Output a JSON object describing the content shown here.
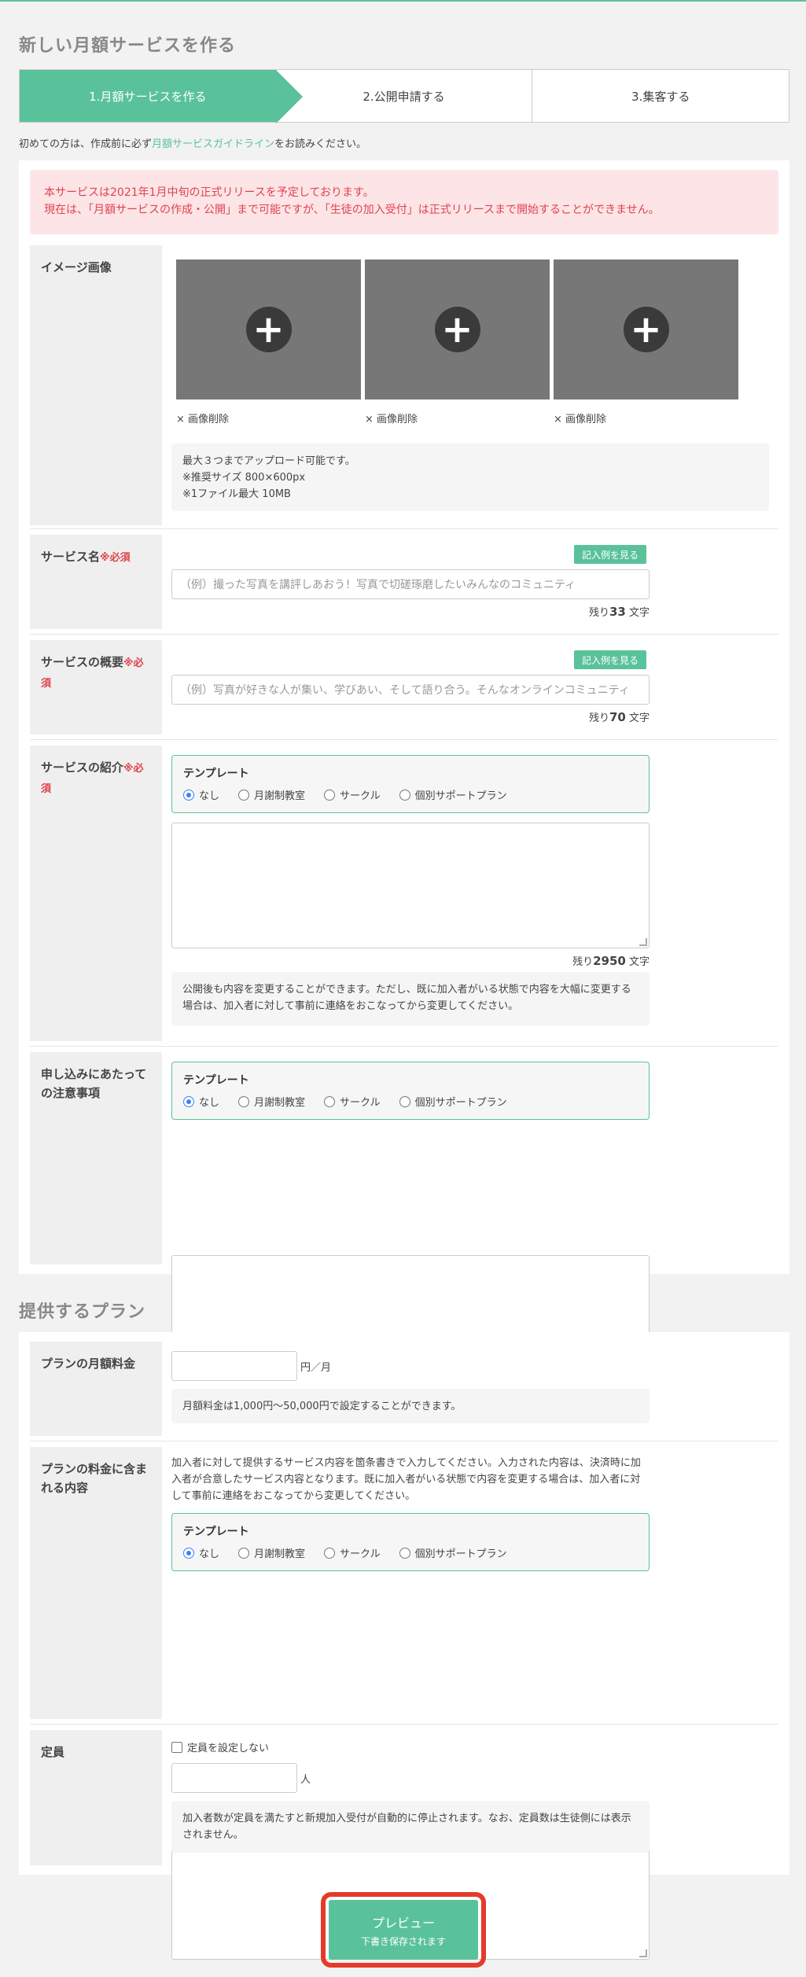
{
  "page_title": "新しい月額サービスを作る",
  "steps": [
    "1.月額サービスを作る",
    "2.公開申請する",
    "3.集客する"
  ],
  "guide": {
    "prefix": "初めての方は、作成前に必ず",
    "link": "月額サービスガイドライン",
    "suffix": "をお読みください。"
  },
  "alert": {
    "line1": "本サービスは2021年1月中旬の正式リリースを予定しております。",
    "line2": "現在は、「月額サービスの作成・公開」まで可能ですが、「生徒の加入受付」は正式リリースまで開始することができません。"
  },
  "image_section": {
    "label": "イメージ画像",
    "delete_label": "× 画像削除",
    "info": [
      "最大３つまでアップロード可能です。",
      "※推奨サイズ 800×600px",
      "※1ファイル最大 10MB"
    ]
  },
  "required_mark": "※必須",
  "example_button": "記入例を見る",
  "remaining_prefix": "残り",
  "remaining_suffix": "文字",
  "service_name": {
    "label": "サービス名",
    "placeholder": "（例）撮った写真を講評しあおう！写真で切磋琢磨したいみんなのコミュニティ",
    "remaining": "33"
  },
  "service_summary": {
    "label": "サービスの概要",
    "placeholder": "（例）写真が好きな人が集い、学びあい、そして語り合う。そんなオンラインコミュニティ",
    "remaining": "70"
  },
  "template": {
    "title": "テンプレート",
    "options": [
      "なし",
      "月謝制教室",
      "サークル",
      "個別サポートプラン"
    ]
  },
  "service_intro": {
    "label": "サービスの紹介",
    "remaining": "2950",
    "info": [
      "公開後も内容を変更することができます。ただし、既に加入者がいる状態で内容を大幅に変更する",
      "場合は、加入者に対して事前に連絡をおこなってから変更してください。"
    ]
  },
  "notes": {
    "label_line1": "申し込みにあたって",
    "label_line2": "の注意事項"
  },
  "plan_heading": "提供するプラン",
  "plan_fee": {
    "label": "プランの月額料金",
    "unit": "円／月",
    "info": "月額料金は1,000円〜50,000円で設定することができます。"
  },
  "plan_content": {
    "label_line1": "プランの料金に含ま",
    "label_line2": "れる内容",
    "desc": [
      "加入者に対して提供するサービス内容を箇条書きで入力してください。入力された内容は、決済時に加",
      "入者が合意したサービス内容となります。既に加入者がいる状態で内容を変更する場合は、加入者に対",
      "して事前に連絡をおこなってから変更してください。"
    ]
  },
  "capacity": {
    "label": "定員",
    "checkbox": "定員を設定しない",
    "unit": "人",
    "info": [
      "加入者数が定員を満たすと新規加入受付が自動的に停止されます。なお、定員数は生徒側には表示",
      "されません。"
    ]
  },
  "preview_button": {
    "title": "プレビュー",
    "sub": "下書き保存されます"
  }
}
